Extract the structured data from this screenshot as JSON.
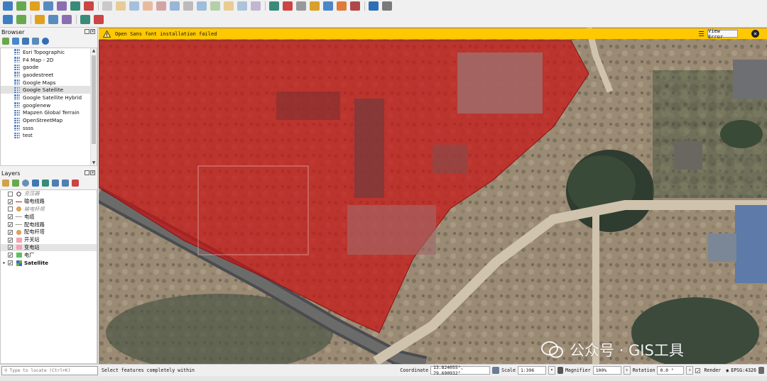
{
  "toolbar1": {
    "icons": [
      "new-project-icon",
      "open-project-icon",
      "save-project-icon",
      "manage-layers-icon",
      "print-layout-icon",
      "layout-manager-icon",
      "style-manager-icon",
      "digitize-icon",
      "edit-pencil-icon",
      "save-edits-icon",
      "vertex-tool-icon",
      "add-feature-icon",
      "move-feature-icon",
      "delete-feature-icon",
      "cut-icon",
      "copy-icon",
      "paste-icon",
      "undo-icon",
      "redo-icon",
      "label-icon",
      "label-pin-icon",
      "label-show-icon",
      "label-move-icon",
      "label-rotate-icon",
      "label-change-icon",
      "label-tool-icon",
      "python-icon",
      "processing-icon"
    ]
  },
  "toolbar2": {
    "icons": [
      "pan-map-icon",
      "pan-to-selection-icon",
      "zoom-in-icon",
      "zoom-full-icon",
      "zoom-select-icon",
      "identify-icon",
      "measure-icon"
    ]
  },
  "browser": {
    "title": "Browser",
    "items": [
      {
        "label": "Esri Topographic"
      },
      {
        "label": "F4 Map - 2D"
      },
      {
        "label": "gaode"
      },
      {
        "label": "gaodestreet"
      },
      {
        "label": "Google Maps"
      },
      {
        "label": "Google Satellite"
      },
      {
        "label": "Google Satellite Hybrid"
      },
      {
        "label": "googlenew"
      },
      {
        "label": "Mapzen Global Terrain"
      },
      {
        "label": "OpenStreetMap"
      },
      {
        "label": "ssss"
      },
      {
        "label": "test"
      }
    ],
    "selected_index": 5
  },
  "layers": {
    "title": "Layers",
    "items": [
      {
        "label": "变压器",
        "checked": false,
        "symbol": "circle-outline",
        "dim": true
      },
      {
        "label": "输电线路",
        "checked": true,
        "symbol": "red-line",
        "dim": false
      },
      {
        "label": "输电杆塔",
        "checked": false,
        "symbol": "orange-circle",
        "dim": true
      },
      {
        "label": "电缆",
        "checked": true,
        "symbol": "dashed-line",
        "dim": false
      },
      {
        "label": "配电线路",
        "checked": true,
        "symbol": "dashed-line",
        "dim": false
      },
      {
        "label": "配电杆塔",
        "checked": true,
        "symbol": "orange-circle",
        "dim": false
      },
      {
        "label": "开关站",
        "checked": true,
        "symbol": "pink-fill",
        "dim": false
      },
      {
        "label": "变电站",
        "checked": true,
        "symbol": "pink-fill",
        "dim": false
      },
      {
        "label": "电厂",
        "checked": true,
        "symbol": "green-fill",
        "dim": false
      },
      {
        "label": "Satellite",
        "checked": true,
        "symbol": "raster",
        "dim": false
      }
    ],
    "selected_index": 7
  },
  "message": {
    "text": "Open Sans font installation failed",
    "button": "View Error"
  },
  "watermark": {
    "text": "公众号 · GIS工具"
  },
  "status": {
    "locator_placeholder": "Type to locate (Ctrl+K)",
    "message": "Select features completely within",
    "coordinate_label": "Coordinate",
    "coordinate_value": "13.824055°, 79.690932°",
    "scale_label": "Scale",
    "scale_value": "1:396",
    "magnifier_label": "Magnifier",
    "magnifier_value": "100%",
    "rotation_label": "Rotation",
    "rotation_value": "0.0 °",
    "render_label": "Render",
    "crs": "EPSG:4326"
  },
  "colors": {
    "message_bar": "#ffc800",
    "polygon_fill": "#c81414",
    "layer_pink": "#f3a3b3",
    "layer_green": "#5bc15b"
  }
}
